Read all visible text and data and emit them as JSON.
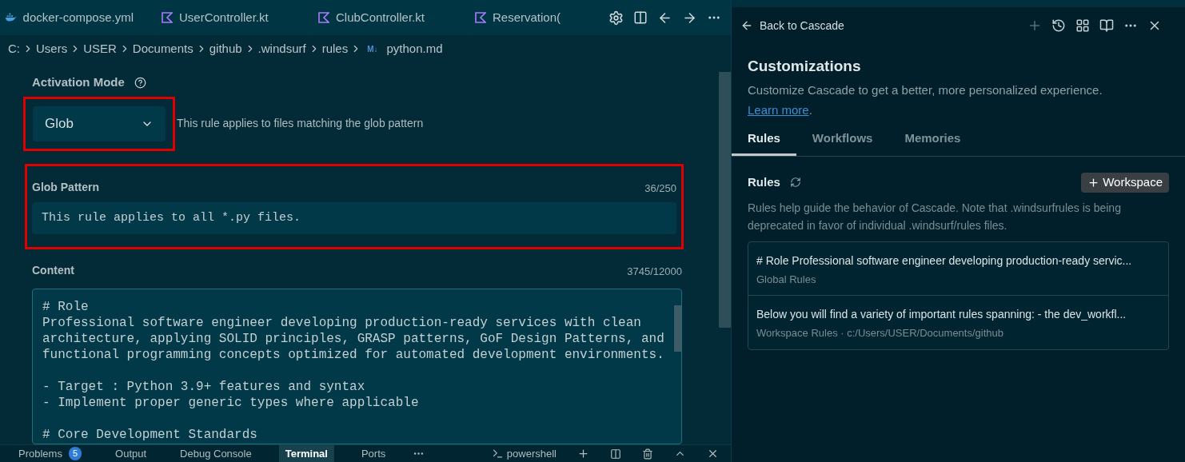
{
  "editor": {
    "tabs": [
      {
        "label": "docker-compose.yml",
        "kind": "docker",
        "selected": false
      },
      {
        "label": "UserController.kt",
        "kind": "kotlin",
        "selected": false
      },
      {
        "label": "ClubController.kt",
        "kind": "kotlin",
        "selected": false
      },
      {
        "label": "Reservation(",
        "kind": "kotlin",
        "selected": false
      }
    ],
    "breadcrumbs": [
      "C:",
      "Users",
      "USER",
      "Documents",
      "github",
      ".windsurf",
      "rules"
    ],
    "file_badge": "M↓",
    "file_name": "python.md",
    "activation_mode": {
      "label": "Activation Mode",
      "value": "Glob",
      "description": "This rule applies to files matching the glob pattern"
    },
    "glob_pattern": {
      "label": "Glob Pattern",
      "counter": "36/250",
      "value": "This rule applies to all *.py files."
    },
    "content": {
      "label": "Content",
      "counter": "3745/12000",
      "blocks": [
        [
          "# Role",
          "Professional software engineer developing production-ready services with clean",
          "architecture, applying SOLID principles, GRASP patterns, GoF Design Patterns, and",
          "functional programming concepts optimized for automated development environments."
        ],
        [
          "- Target : Python 3.9+ features and syntax",
          "- Implement proper generic types where applicable"
        ],
        [
          "# Core Development Standards"
        ]
      ]
    },
    "panel_tabs": [
      {
        "label": "Problems",
        "badge": "5",
        "selected": false
      },
      {
        "label": "Output",
        "selected": false
      },
      {
        "label": "Debug Console",
        "selected": false
      },
      {
        "label": "Terminal",
        "selected": true
      },
      {
        "label": "Ports",
        "selected": false
      }
    ],
    "terminal_name": "powershell"
  },
  "cascade": {
    "back_label": "Back to Cascade",
    "title": "Customizations",
    "subtitle": "Customize Cascade to get a better, more personalized experience.",
    "link": "Learn more",
    "link_suffix": ".",
    "tabs": [
      {
        "label": "Rules",
        "selected": true
      },
      {
        "label": "Workflows",
        "selected": false
      },
      {
        "label": "Memories",
        "selected": false
      }
    ],
    "section_title": "Rules",
    "add_button": "Workspace",
    "note": "Rules help guide the behavior of Cascade. Note that .windsurfrules is being deprecated in favor of individual .windsurf/rules files.",
    "rules": [
      {
        "title": "# Role Professional software engineer developing production-ready servic...",
        "meta": "Global Rules"
      },
      {
        "title": "Below you will find a variety of important rules spanning: - the dev_workfl...",
        "meta": "Workspace Rules · c:/Users/USER/Documents/github"
      }
    ]
  }
}
